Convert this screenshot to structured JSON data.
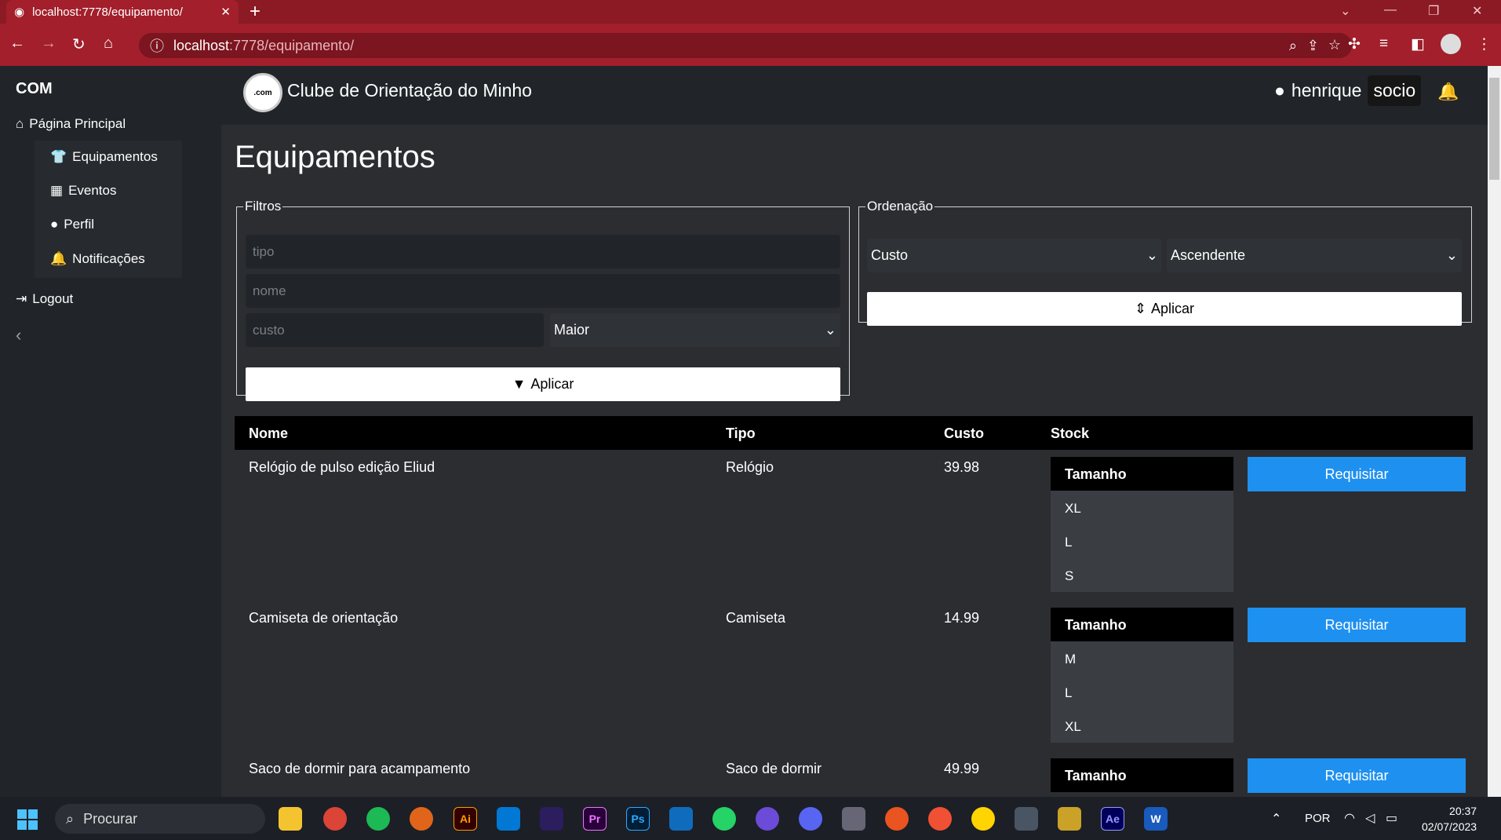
{
  "browser": {
    "tab_title": "localhost:7778/equipamento/",
    "url_host": "localhost",
    "url_rest": ":7778/equipamento/"
  },
  "sidebar": {
    "brand": "COM",
    "home": "Página Principal",
    "items": [
      {
        "label": "Equipamentos",
        "icon": "shirt-icon"
      },
      {
        "label": "Eventos",
        "icon": "calendar-icon"
      },
      {
        "label": "Perfil",
        "icon": "user-icon"
      },
      {
        "label": "Notificações",
        "icon": "bell-icon"
      }
    ],
    "logout": "Logout"
  },
  "header": {
    "logo_text": ".com",
    "title": "Clube de Orientação do Minho",
    "username": "henrique",
    "role": "socio"
  },
  "page": {
    "title": "Equipamentos"
  },
  "filters": {
    "legend": "Filtros",
    "tipo_placeholder": "tipo",
    "nome_placeholder": "nome",
    "custo_placeholder": "custo",
    "compare_selected": "Maior",
    "apply": "Aplicar"
  },
  "ordering": {
    "legend": "Ordenação",
    "field_selected": "Custo",
    "direction_selected": "Ascendente",
    "apply": "Aplicar"
  },
  "table": {
    "headers": [
      "Nome",
      "Tipo",
      "Custo",
      "Stock"
    ],
    "size_header": "Tamanho",
    "request_label": "Requisitar",
    "rows": [
      {
        "nome": "Relógio de pulso edição Eliud",
        "tipo": "Relógio",
        "custo": "39.98",
        "sizes": [
          "XL",
          "L",
          "S"
        ]
      },
      {
        "nome": "Camiseta de orientação",
        "tipo": "Camiseta",
        "custo": "14.99",
        "sizes": [
          "M",
          "L",
          "XL"
        ]
      },
      {
        "nome": "Saco de dormir para acampamento",
        "tipo": "Saco de dormir",
        "custo": "49.99",
        "sizes": []
      }
    ]
  },
  "taskbar": {
    "search": "Procurar",
    "lang": "POR",
    "time": "20:37",
    "date": "02/07/2023"
  }
}
